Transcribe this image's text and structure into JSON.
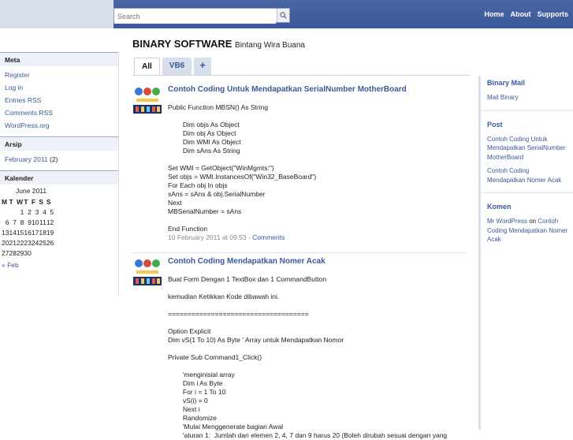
{
  "topbar": {
    "search_placeholder": "Search",
    "nav": [
      "Home",
      "About",
      "Supports"
    ]
  },
  "sidebar": {
    "meta": {
      "title": "Meta",
      "links": [
        "Register",
        "Log in",
        "Entries RSS",
        "Comments RSS",
        "WordPress.org"
      ]
    },
    "arsip": {
      "title": "Arsip",
      "link": "February 2011",
      "count": "(2)"
    },
    "kalender": {
      "title": "Kalender",
      "caption": "June 2011",
      "days": [
        "M",
        "T",
        "W",
        "T",
        "F",
        "S",
        "S"
      ],
      "weeks": [
        [
          "",
          "",
          "1",
          "2",
          "3",
          "4",
          "5"
        ],
        [
          "6",
          "7",
          "8",
          "9",
          "10",
          "11",
          "12"
        ],
        [
          "13",
          "14",
          "15",
          "16",
          "17",
          "18",
          "19"
        ],
        [
          "20",
          "21",
          "22",
          "23",
          "24",
          "25",
          "26"
        ],
        [
          "27",
          "28",
          "29",
          "30",
          "",
          "",
          ""
        ]
      ],
      "prev": "« Feb"
    }
  },
  "header": {
    "site_title": "BINARY SOFTWARE",
    "tagline": "Bintang Wira Buana"
  },
  "tabs": [
    "All",
    "VB6",
    "+"
  ],
  "posts": [
    {
      "title": "Contoh Coding Untuk Mendapatkan SerialNumber MotherBoard",
      "body": "Public Function MBSN() As String\n\n        Dim objs As Object\n        Dim obj As Object\n        Dim WMI As Object\n        Dim sAns As String\n\nSet WMI = GetObject(\"WinMgmts:\")\nSet objs = WMI.InstancesOf(\"Win32_BaseBoard\")\nFor Each obj In objs\nsAns = sAns & obj.SerialNumber\nNext\nMBSerialNumber = sAns\n\nEnd Function",
      "date": "10 February 2011 at 09:53",
      "comments": "Comments"
    },
    {
      "title": "Contoh Coding Mendapatkan Nomer Acak",
      "body": "Buat Form Dengan 1 TextBox dan 1 CommandButton\n\nkemudian Ketikkan Kode dibawah ini.\n\n====================================\n\nOption Explicit\nDim vS(1 To 10) As Byte ' Array untuk Mendapatkan Nomor\n\nPrivate Sub Command1_Click()\n\n        'menginisial array\n        Dim i As Byte\n        For i = 1 To 10\n        vS(i) = 0\n        Next i\n        Randomize\n        'Mulai Menggenerate bagian Awal\n        'aturan 1:  Jumlah dari elemen 2, 4, 7 dan 9 harus 20 (Boleh dirubah sesuai dengan yang"
    }
  ],
  "right": {
    "binary_mail": {
      "title": "Binary Mail",
      "link": "Mail Binary"
    },
    "post": {
      "title": "Post",
      "links": [
        "Contoh Coding Untuk Mendapatkan SerialNumber MotherBoard",
        "Contoh Coding Mendapatkan Nomer Acak"
      ]
    },
    "komen": {
      "title": "Komen",
      "author": "Mr WordPress",
      "on": "on",
      "link": "Contoh Coding Mendapatkan Nomer Acak"
    }
  },
  "colors": {
    "brand": "#3b5998",
    "sidebar_header": "#eef1f7"
  }
}
